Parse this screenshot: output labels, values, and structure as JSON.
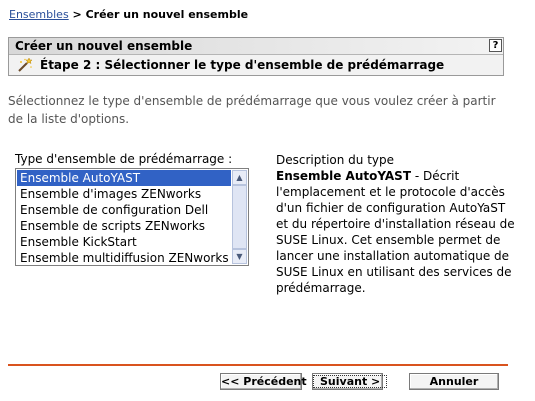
{
  "breadcrumb": {
    "root_link": "Ensembles",
    "separator": ">",
    "current": "Créer un nouvel ensemble"
  },
  "wizard": {
    "title": "Créer un nouvel ensemble",
    "help_label": "?",
    "step_icon": "magic-wand-icon",
    "step_label": "Étape 2 : Sélectionner le type d'ensemble de prédémarrage"
  },
  "instructions": "Sélectionnez le type d'ensemble de prédémarrage que vous voulez créer à partir de la liste d'options.",
  "bundle_type": {
    "label": "Type d'ensemble de prédémarrage :",
    "items": [
      {
        "label": "Ensemble AutoYAST",
        "selected": true
      },
      {
        "label": "Ensemble d'images ZENworks",
        "selected": false
      },
      {
        "label": "Ensemble de configuration Dell",
        "selected": false
      },
      {
        "label": "Ensemble de scripts ZENworks",
        "selected": false
      },
      {
        "label": "Ensemble KickStart",
        "selected": false
      },
      {
        "label": "Ensemble multidiffusion ZENworks",
        "selected": false
      }
    ]
  },
  "description": {
    "title": "Description du type",
    "name": "Ensemble AutoYAST",
    "text": " - Décrit l'emplacement et le protocole d'accès d'un fichier de configuration AutoYaST et du répertoire d'installation réseau de SUSE Linux. Cet ensemble permet de lancer une installation automatique de SUSE Linux en utilisant des services de prédémarrage."
  },
  "buttons": {
    "previous": "<< Précédent",
    "next": "Suivant >",
    "cancel": "Annuler"
  },
  "colors": {
    "link": "#2a4f9a",
    "selection": "#3162c5",
    "divider": "#d9531e"
  }
}
